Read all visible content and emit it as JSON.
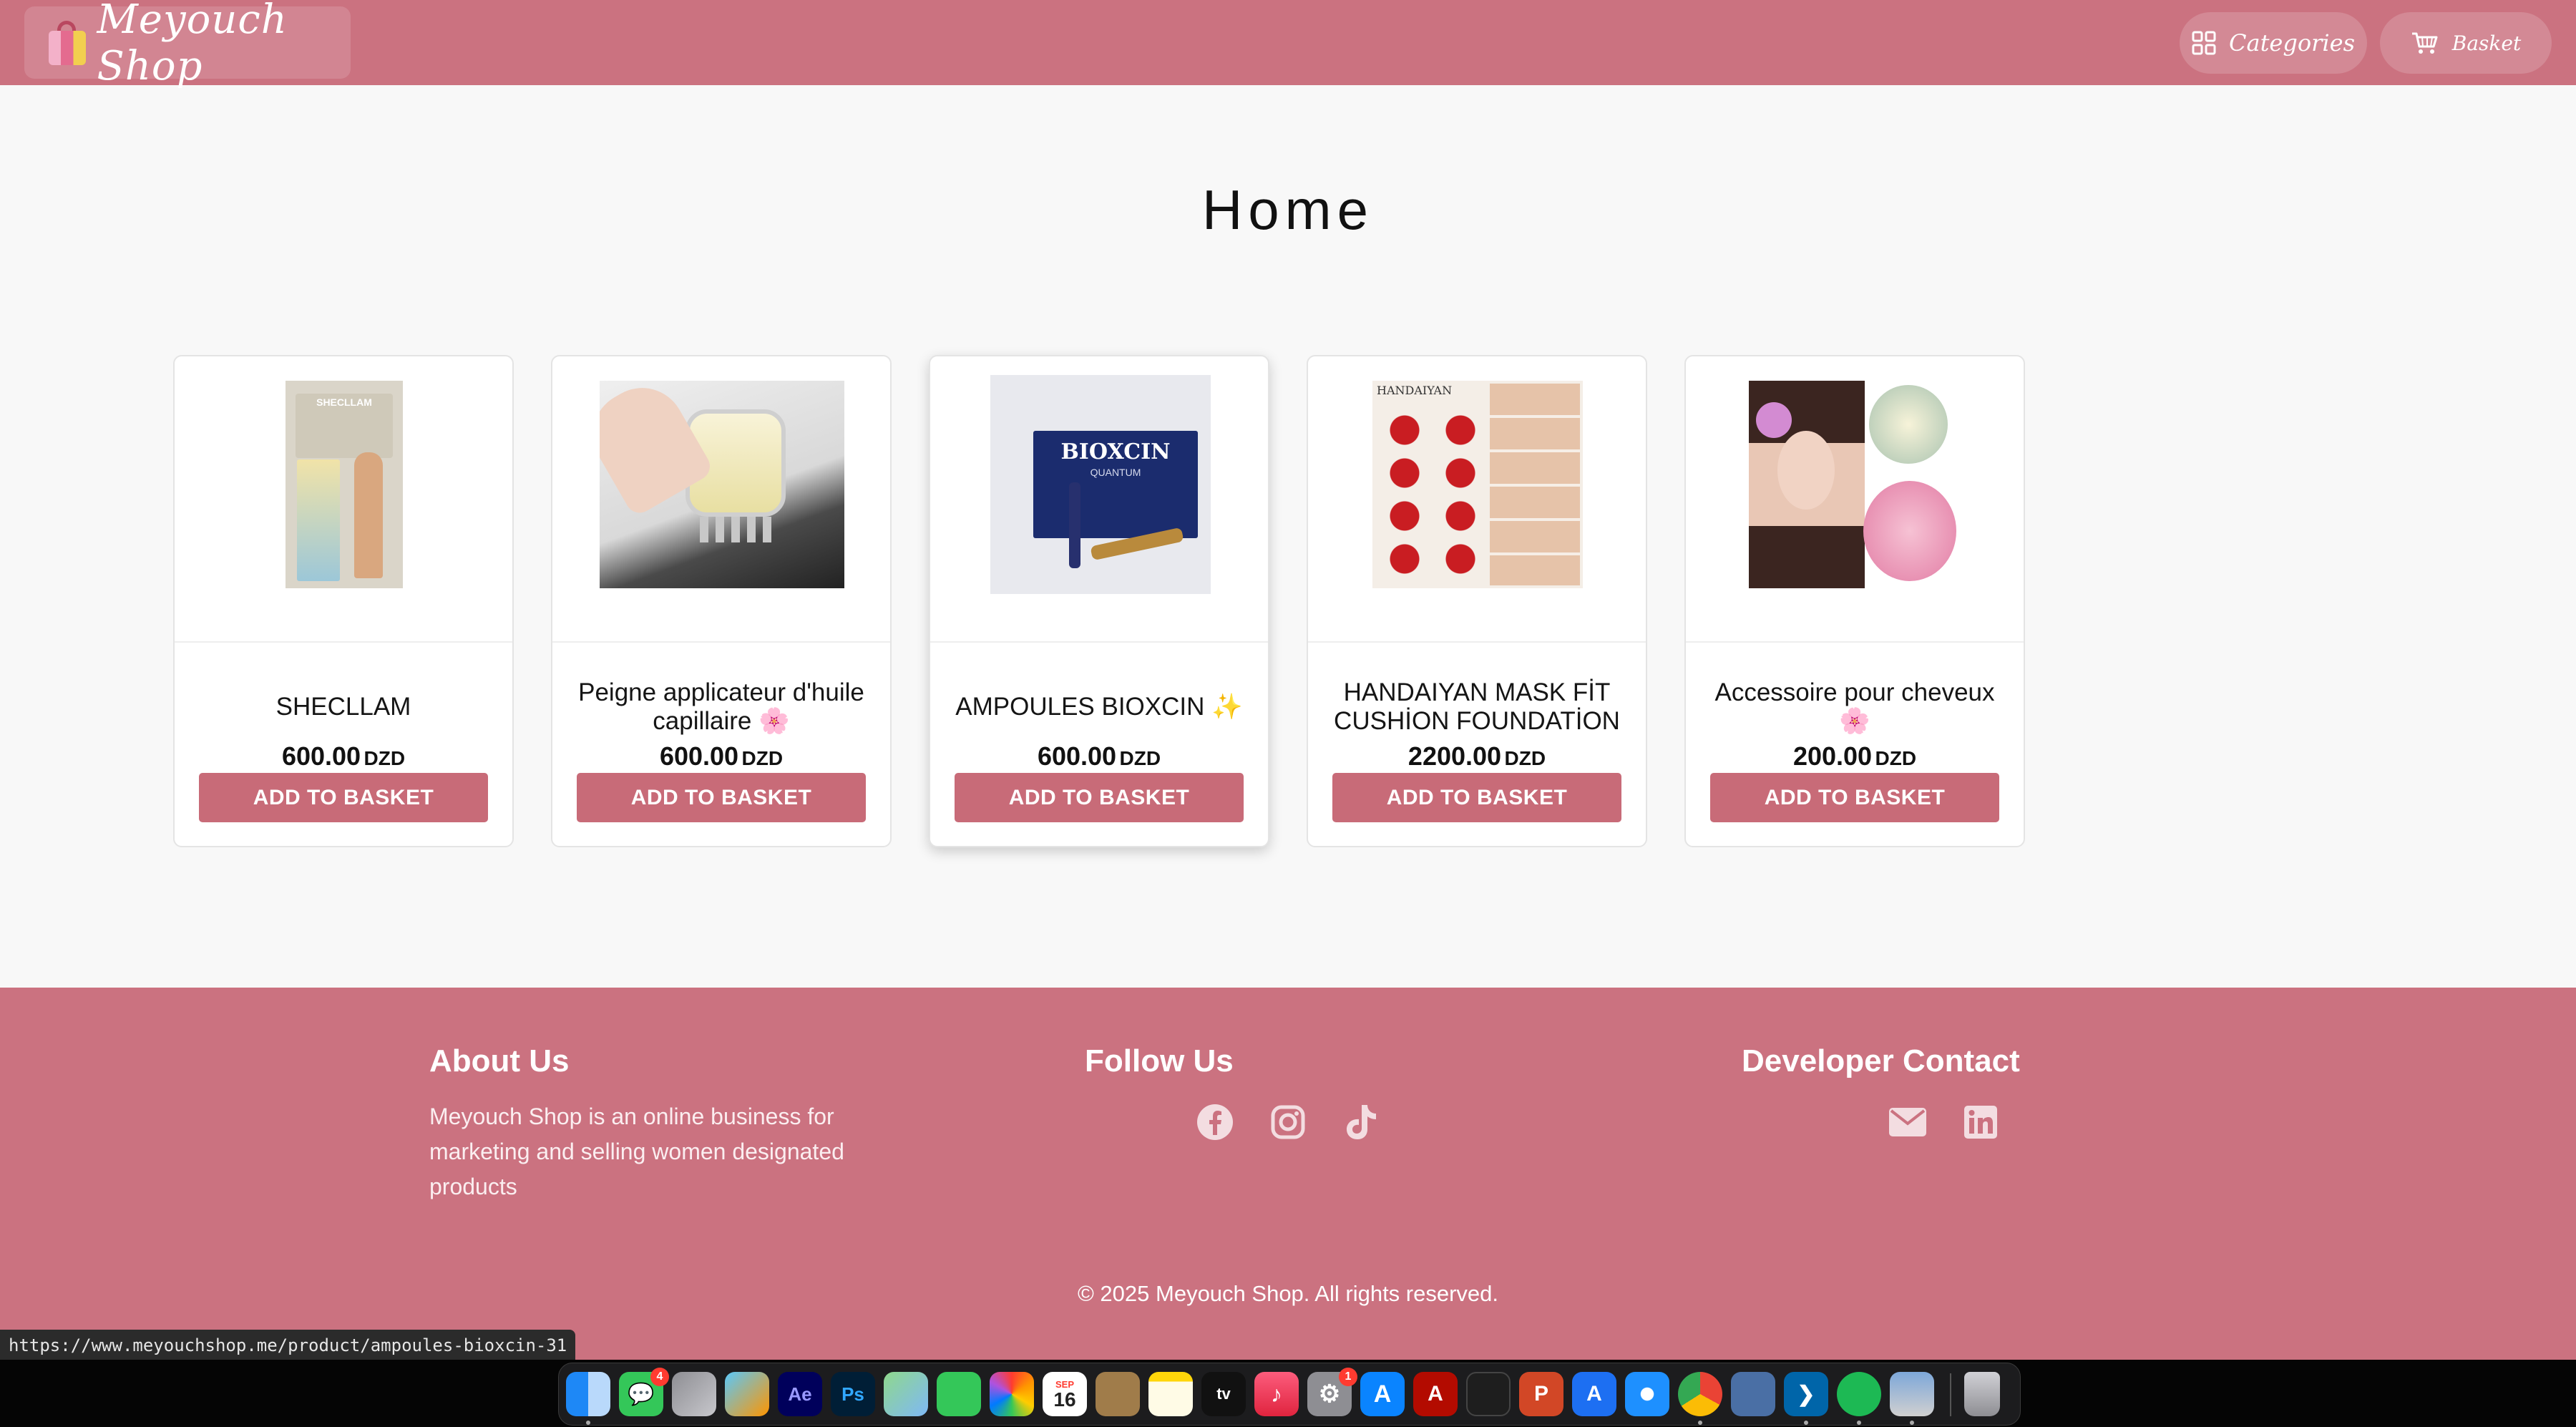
{
  "header": {
    "logo_text": "Meyouch Shop",
    "categories_label": "Categories",
    "basket_label": "Basket"
  },
  "page": {
    "title": "Home"
  },
  "products": [
    {
      "name": "SHECLLAM",
      "price": "600.00",
      "currency": "DZD",
      "button": "ADD TO BASKET"
    },
    {
      "name": "Peigne applicateur d'huile capillaire 🌸",
      "price": "600.00",
      "currency": "DZD",
      "button": "ADD TO BASKET"
    },
    {
      "name": "AMPOULES BIOXCIN ✨",
      "price": "600.00",
      "currency": "DZD",
      "button": "ADD TO BASKET"
    },
    {
      "name": "HANDAIYAN MASK FİT CUSHİON FOUNDATİON",
      "price": "2200.00",
      "currency": "DZD",
      "button": "ADD TO BASKET"
    },
    {
      "name": "Accessoire pour cheveux 🌸",
      "price": "200.00",
      "currency": "DZD",
      "button": "ADD TO BASKET"
    }
  ],
  "product_images": {
    "shecllam": {
      "brand": "SHECLLAM"
    },
    "bioxcin": {
      "brand": "BIOXCIN",
      "sub": "QUANTUM"
    },
    "handaiyan": {
      "brand": "HANDAIYAN"
    }
  },
  "footer": {
    "about_title": "About Us",
    "about_text": "Meyouch Shop is an online business for marketing and selling women designated products",
    "follow_title": "Follow Us",
    "social_icons": [
      "facebook-icon",
      "instagram-icon",
      "tiktok-icon"
    ],
    "contact_title": "Developer Contact",
    "contact_icons": [
      "email-icon",
      "linkedin-icon"
    ],
    "copyright": "© 2025 Meyouch Shop. All rights reserved."
  },
  "status_url": "https://www.meyouchshop.me/product/ampoules-bioxcin-31",
  "dock": {
    "messages_badge": "4",
    "settings_badge": "1",
    "calendar_month": "SEP",
    "calendar_day": "16",
    "after_effects": "Ae",
    "photoshop": "Ps",
    "tv": "tv"
  },
  "colors": {
    "brand": "#cb7280",
    "button": "#c86b78",
    "background": "#f8f8f8"
  }
}
